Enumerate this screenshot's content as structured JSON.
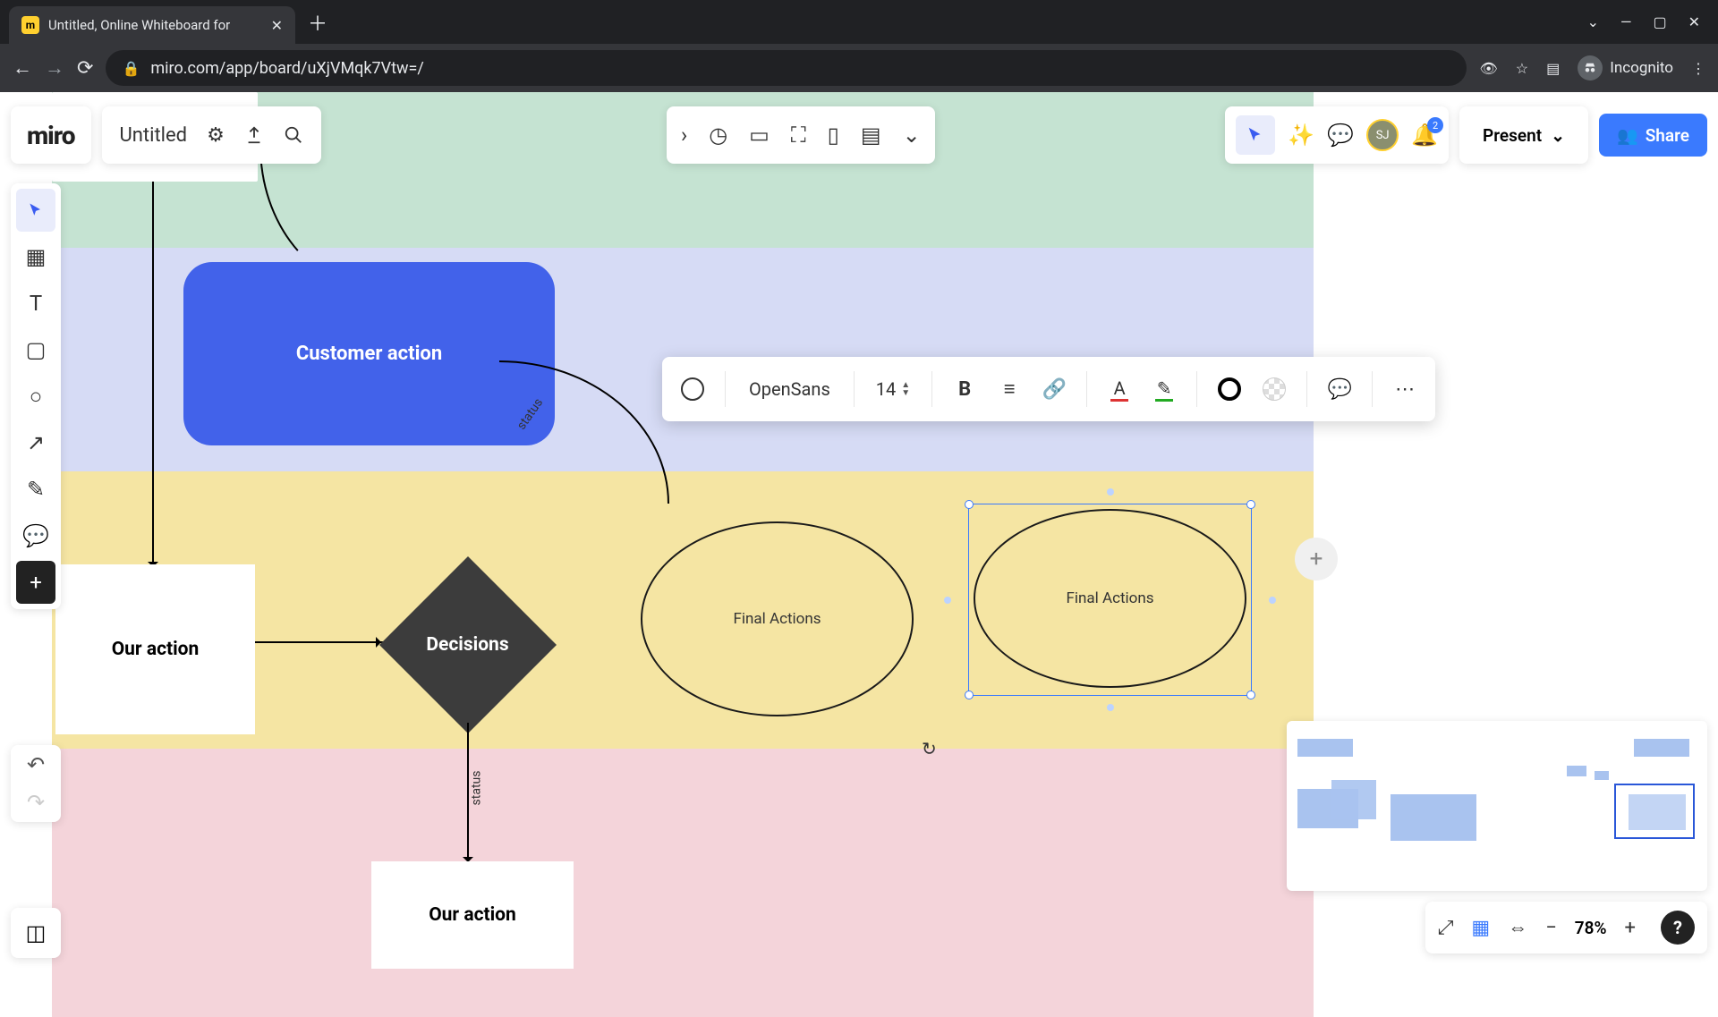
{
  "browser": {
    "tab_title": "Untitled, Online Whiteboard for",
    "url": "miro.com/app/board/uXjVMqk7Vtw=/",
    "incognito_label": "Incognito"
  },
  "header": {
    "logo": "miro",
    "board_title": "Untitled",
    "present_label": "Present",
    "share_label": "Share",
    "avatar_initials": "SJ",
    "notification_count": "2"
  },
  "context_toolbar": {
    "font_name": "OpenSans",
    "font_size": "14"
  },
  "zoom": {
    "percent": "78%"
  },
  "shapes": {
    "customer_action": "Customer action",
    "our_action": "Our action",
    "decisions": "Decisions",
    "final_actions_1": "Final Actions",
    "final_actions_2": "Final Actions",
    "our_action_bottom": "Our action",
    "status_label_1": "status",
    "status_label_2": "status"
  }
}
